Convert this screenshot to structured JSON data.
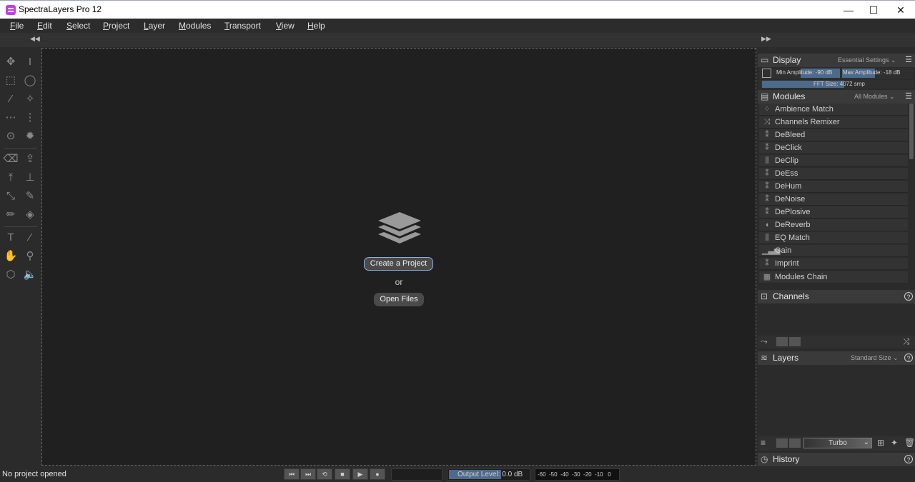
{
  "window": {
    "title": "SpectraLayers Pro 12",
    "minimize": "—",
    "maximize": "☐",
    "close": "✕"
  },
  "menu": [
    "File",
    "Edit",
    "Select",
    "Project",
    "Layer",
    "Modules",
    "Transport",
    "View",
    "Help"
  ],
  "canvas": {
    "create_label": "Create a Project",
    "or_label": "or",
    "open_label": "Open Files"
  },
  "display": {
    "title": "Display",
    "option": "Essential Settings",
    "min_amp": "Min Amplitude: -90 dB",
    "max_amp": "Max Amplitude: -18 dB",
    "fft": "FFT Size: 4072 smp"
  },
  "modules": {
    "title": "Modules",
    "option": "All Modules",
    "items": [
      "Ambience Match",
      "Channels Remixer",
      "DeBleed",
      "DeClick",
      "DeClip",
      "DeEss",
      "DeHum",
      "DeNoise",
      "DePlosive",
      "DeReverb",
      "EQ Match",
      "Gain",
      "Imprint",
      "Modules Chain"
    ]
  },
  "channels": {
    "title": "Channels"
  },
  "layers": {
    "title": "Layers",
    "option": "Standard Size",
    "colormap": "Turbo"
  },
  "history": {
    "title": "History"
  },
  "status": {
    "text": "No project opened",
    "output_level": "Output Level: 0.0 dB",
    "meter_scale": "-60  -50  -40  -30  -20  -10   0"
  },
  "colors": {
    "accent": "#8fb1e0",
    "canvas_bg": "#202020",
    "panel_bg": "#2b2b2b"
  }
}
